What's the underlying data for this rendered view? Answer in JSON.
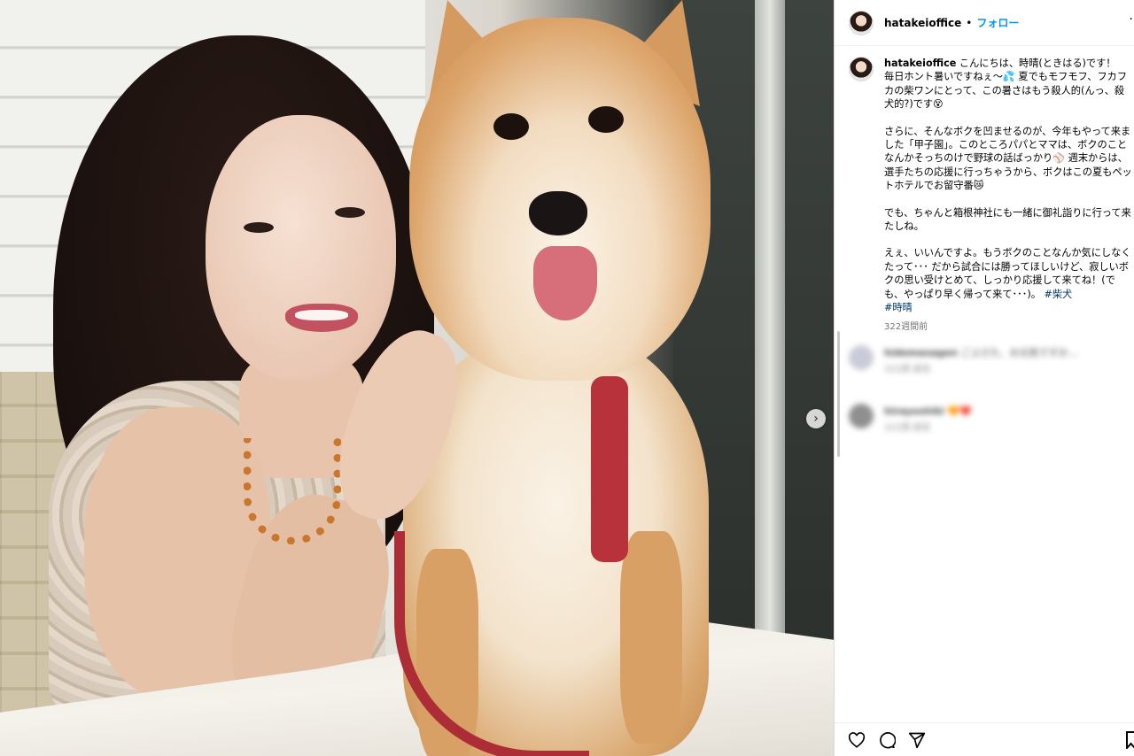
{
  "post": {
    "username": "hatakeioffice",
    "separator": "•",
    "follow_label": "フォロー",
    "more_label": "·"
  },
  "caption": {
    "username": "hatakeioffice",
    "p1": "こんにちは、時晴(ときはる)です！\n毎日ホント暑いですねぇ〜💦 夏でもモフモフ、フカフカの柴ワンにとって、この暑さはもう殺人的(んっ、殺犬的?)です😵",
    "p2": "さらに、そんなボクを凹ませるのが、今年もやって来ました「甲子園」。このところパパとママは、ボクのことなんかそっちのけで野球の話ばっかり⚾ 週末からは、選手たちの応援に行っちゃうから、ボクはこの夏もペットホテルでお留守番😿",
    "p3": "でも、ちゃんと箱根神社にも一緒に御礼詣りに行って来たしね。",
    "p4": "えぇ、いいんですよ。もうボクのことなんか気にしなくたって･･･ だから試合には勝ってほしいけど、寂しいボクの思い受けとめて、しっかり応援して来てね！(でも、やっぱり早く帰って来て･･･)。",
    "tag1": "#柴犬",
    "tag2": "#時晴",
    "age": "322週間前"
  },
  "comments": [
    {
      "user": "hidemasagen",
      "text": "ごぶさた、お元気ですか…",
      "sub": "322週  返信"
    },
    {
      "user": "hirayoshiki",
      "text": "🧡❤️",
      "sub": "322週  返信"
    }
  ],
  "icons": {
    "like": "heart-icon",
    "comment": "comment-icon",
    "share": "paper-plane-icon",
    "save": "bookmark-icon",
    "next": "chevron-right-icon"
  },
  "carousel": {
    "next_glyph": "›"
  },
  "colors": {
    "accent": "#0095f6",
    "hashtag": "#00376b"
  }
}
